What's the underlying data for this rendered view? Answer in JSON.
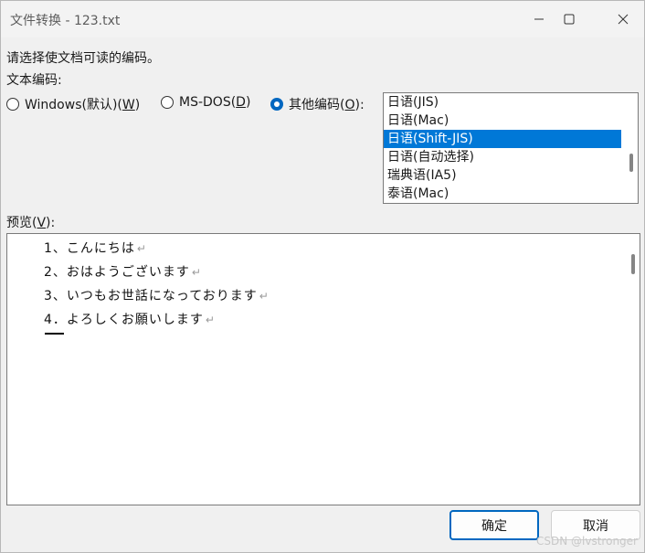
{
  "window": {
    "title": "文件转换 - 123.txt"
  },
  "prompt": "请选择使文档可读的编码。",
  "encoding_label": "文本编码:",
  "radios": {
    "windows": {
      "text": "Windows(默认)(",
      "key": "W",
      "end": ")",
      "checked": false
    },
    "msdos": {
      "text": "MS-DOS(",
      "key": "D",
      "end": ")",
      "checked": false
    },
    "other": {
      "text": "其他编码(",
      "key": "O",
      "end": "):",
      "checked": true
    }
  },
  "encodings": [
    {
      "label": "日语(JIS)",
      "selected": false
    },
    {
      "label": "日语(Mac)",
      "selected": false
    },
    {
      "label": "日语(Shift-JIS)",
      "selected": true
    },
    {
      "label": "日语(自动选择)",
      "selected": false
    },
    {
      "label": "瑞典语(IA5)",
      "selected": false
    },
    {
      "label": "泰语(Mac)",
      "selected": false
    }
  ],
  "preview_label": {
    "text": "预览(",
    "key": "V",
    "end": "):"
  },
  "preview_lines": [
    "1、こんにちは",
    "2、おはようございます",
    "3、いつもお世話になっております",
    "4．よろしくお願いします"
  ],
  "paragraph_mark": "↵",
  "buttons": {
    "ok": "确定",
    "cancel": "取消"
  },
  "watermark": "CSDN @lvstronger",
  "colors": {
    "accent": "#0067c0",
    "selection": "#0078d7"
  }
}
